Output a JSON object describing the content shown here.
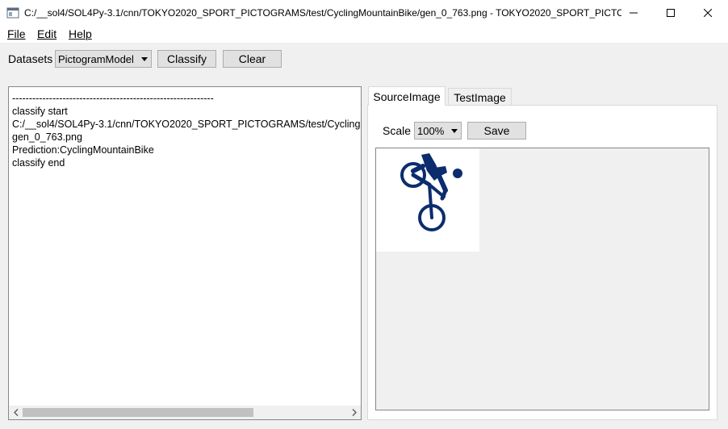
{
  "window": {
    "title": "C:/__sol4/SOL4Py-3.1/cnn/TOKYO2020_SPORT_PICTOGRAMS/test/CyclingMountainBike/gen_0_763.png - TOKYO2020_SPORT_PICTOGRA..."
  },
  "menu": {
    "items": [
      {
        "label": "File"
      },
      {
        "label": "Edit"
      },
      {
        "label": "Help"
      }
    ]
  },
  "toolbar": {
    "datasets_label": "Datasets",
    "dataset_selected": "PictogramModel",
    "classify_label": "Classify",
    "clear_label": "Clear"
  },
  "log": {
    "text": "------------------------------------------------------------\nclassify start\nC:/__sol4/SOL4Py-3.1/cnn/TOKYO2020_SPORT_PICTOGRAMS/test/CyclingMountainBike/\ngen_0_763.png\nPrediction:CyclingMountainBike\nclassify end"
  },
  "tabs": [
    {
      "label": "SourceImage",
      "active": true
    },
    {
      "label": "TestImage",
      "active": false
    }
  ],
  "image_panel": {
    "scale_label": "Scale",
    "scale_selected": "100%",
    "save_label": "Save"
  },
  "colors": {
    "pictogram": "#0b2d6e"
  }
}
